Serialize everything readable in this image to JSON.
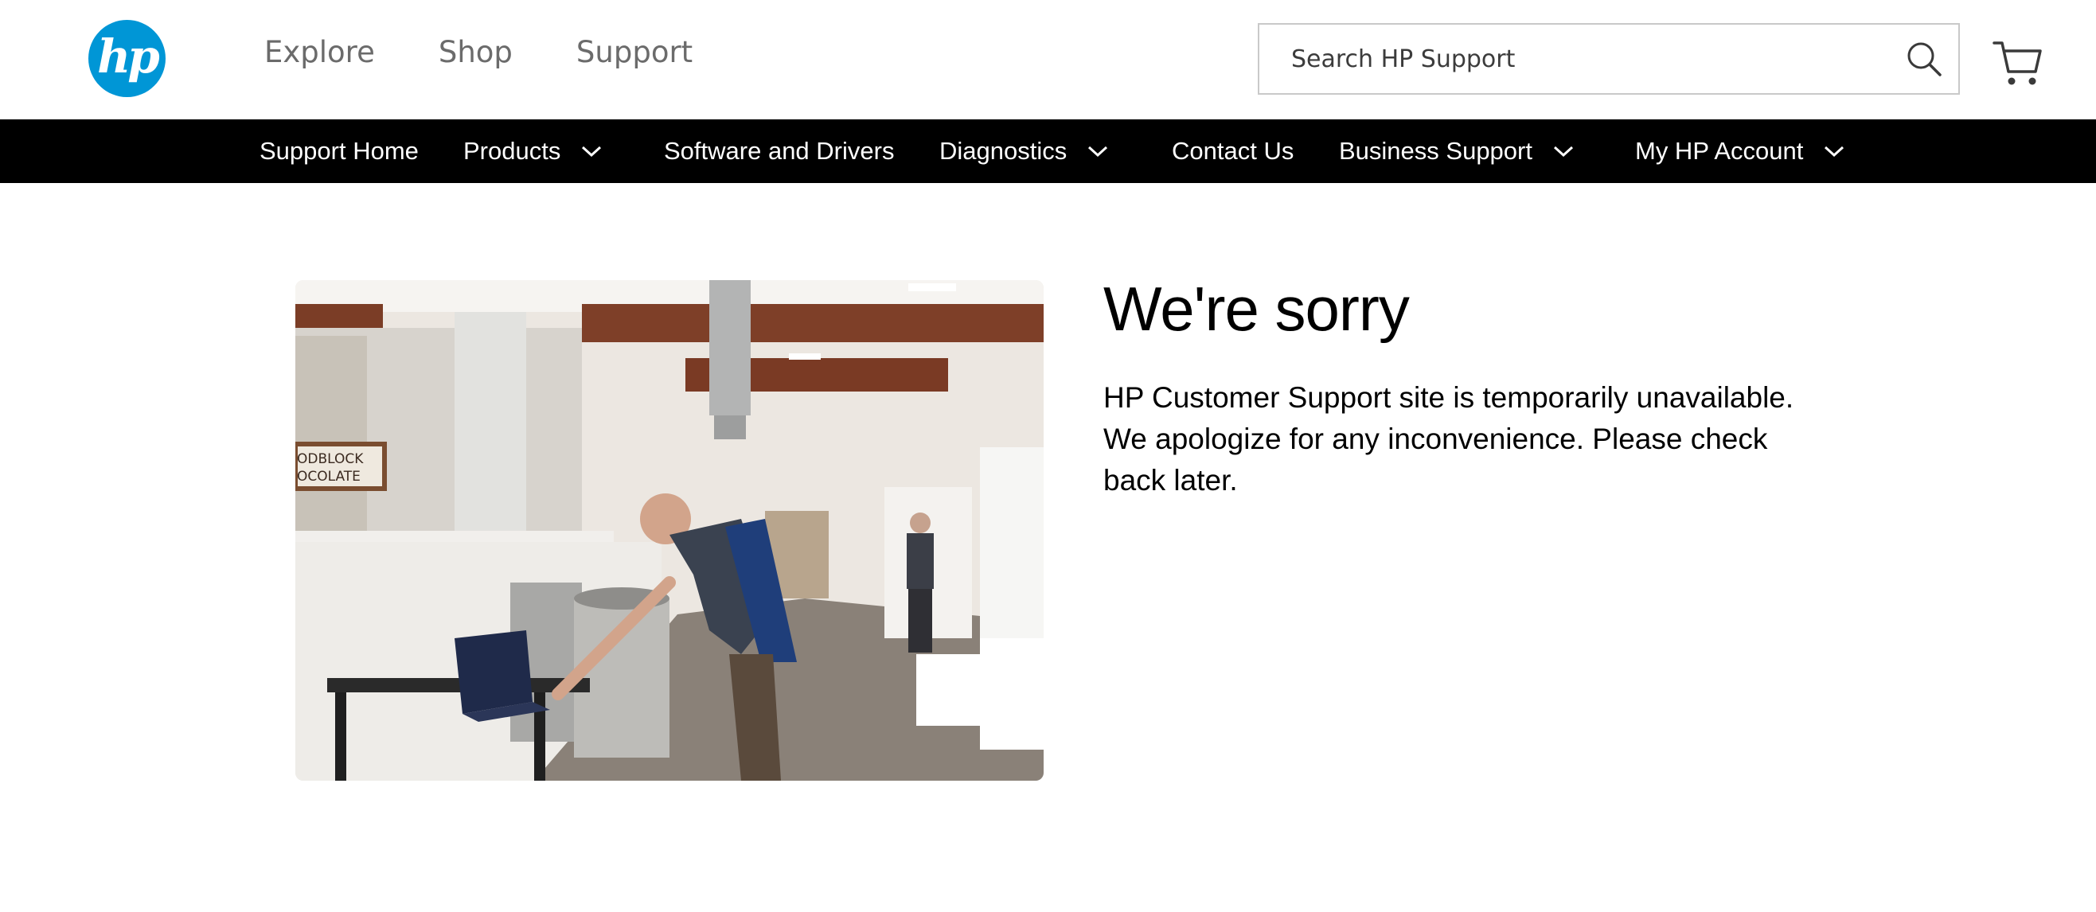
{
  "header": {
    "logo_text": "hp",
    "nav": [
      {
        "label": "Explore"
      },
      {
        "label": "Shop"
      },
      {
        "label": "Support"
      }
    ],
    "search": {
      "placeholder": "Search HP Support",
      "icon": "search-icon"
    },
    "cart": {
      "icon": "cart-icon"
    }
  },
  "subnav": {
    "items": [
      {
        "label": "Support Home",
        "has_dropdown": false
      },
      {
        "label": "Products",
        "has_dropdown": true
      },
      {
        "label": "Software and Drivers",
        "has_dropdown": false
      },
      {
        "label": "Diagnostics",
        "has_dropdown": true
      },
      {
        "label": "Contact Us",
        "has_dropdown": false
      },
      {
        "label": "Business Support",
        "has_dropdown": true
      },
      {
        "label": "My HP Account",
        "has_dropdown": true
      }
    ]
  },
  "main": {
    "title": "We're sorry",
    "message": "HP Customer Support site is temporarily unavailable. We apologize for any inconvenience. Please check back later.",
    "image": {
      "sign_line1": "ODBLOCK",
      "sign_line2": "OCOLATE"
    }
  },
  "colors": {
    "brand_blue": "#0096d6",
    "nav_bar": "#000000",
    "nav_text": "#6b6b6b"
  }
}
